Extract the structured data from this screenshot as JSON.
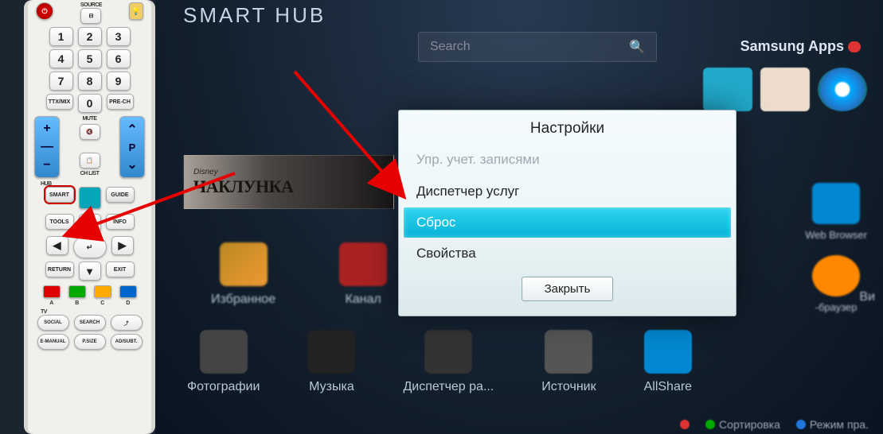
{
  "remote": {
    "source": "SOURCE",
    "numpad": [
      "1",
      "2",
      "3",
      "4",
      "5",
      "6",
      "7",
      "8",
      "9",
      "0"
    ],
    "ttx": "TTX/MIX",
    "prech": "PRE-CH",
    "mute": "MUTE",
    "chlist": "CH LIST",
    "hub": "HUB",
    "smart": "SMART",
    "guide": "GUIDE",
    "tools": "TOOLS",
    "info": "INFO",
    "return": "RETURN",
    "exit": "EXIT",
    "color_a": "A",
    "color_b": "B",
    "color_c": "C",
    "color_d": "D",
    "tv": "TV",
    "social": "SOCIAL",
    "search": "SEARCH",
    "emanual": "E-MANUAL",
    "psize": "P.SIZE",
    "adsubt": "AD/SUBT.",
    "vol_plus": "+",
    "vol_minus": "−",
    "p": "P"
  },
  "tv": {
    "title": "SMART HUB",
    "search_placeholder": "Search",
    "samsung_apps": "Samsung Apps",
    "web_browser": "Web Browser",
    "browser_suffix": "-браузер",
    "vi": "Ви",
    "banner_brand": "Disney",
    "banner_title": "ЧАКЛУНКА",
    "apps": {
      "favorites": "Избранное",
      "channel": "Канал",
      "photos": "Фотографии",
      "music": "Музыка",
      "dispatcher": "Диспетчер ра...",
      "source": "Источник",
      "allshare": "AllShare"
    }
  },
  "dialog": {
    "title": "Настройки",
    "items": {
      "accounts": "Упр. учет. записями",
      "services": "Диспетчер услуг",
      "reset": "Сброс",
      "properties": "Свойства"
    },
    "close": "Закрыть"
  },
  "footer": {
    "sort": "Сортировка",
    "mode": "Режим пра."
  }
}
